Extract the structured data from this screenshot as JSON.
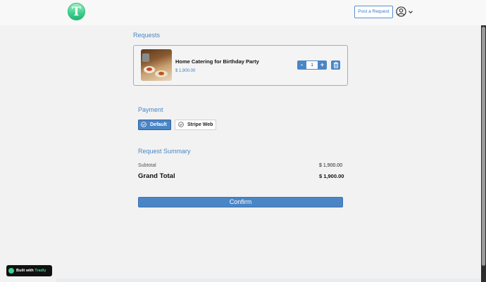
{
  "header": {
    "logo_letter": "T",
    "post_request_label": "Post a Request",
    "avatar_icon": "user-circle-icon",
    "menu_icon": "chevron-down-icon"
  },
  "requests": {
    "title": "Requests",
    "items": [
      {
        "title": "Home Catering for Birthday Party",
        "price": "$ 1,900.00",
        "quantity": "1",
        "minus_label": "-",
        "plus_label": "+",
        "delete_icon": "trash-icon"
      }
    ]
  },
  "payment": {
    "title": "Payment",
    "options": [
      {
        "label": "Default",
        "selected": true,
        "icon": "check-circle-icon"
      },
      {
        "label": "Stripe Web",
        "selected": false,
        "icon": "check-circle-icon"
      }
    ]
  },
  "summary": {
    "title": "Request Summary",
    "subtotal_label": "Subtotal",
    "subtotal_value": "$ 1,900.00",
    "grand_total_label": "Grand Total",
    "grand_total_value": "$ 1,900.00"
  },
  "confirm_label": "Confirm",
  "badge": {
    "prefix": "Built with",
    "brand": "Tradly"
  },
  "colors": {
    "accent": "#4a86c6",
    "brand": "#3ecf8e",
    "background": "#f2f2f2"
  }
}
